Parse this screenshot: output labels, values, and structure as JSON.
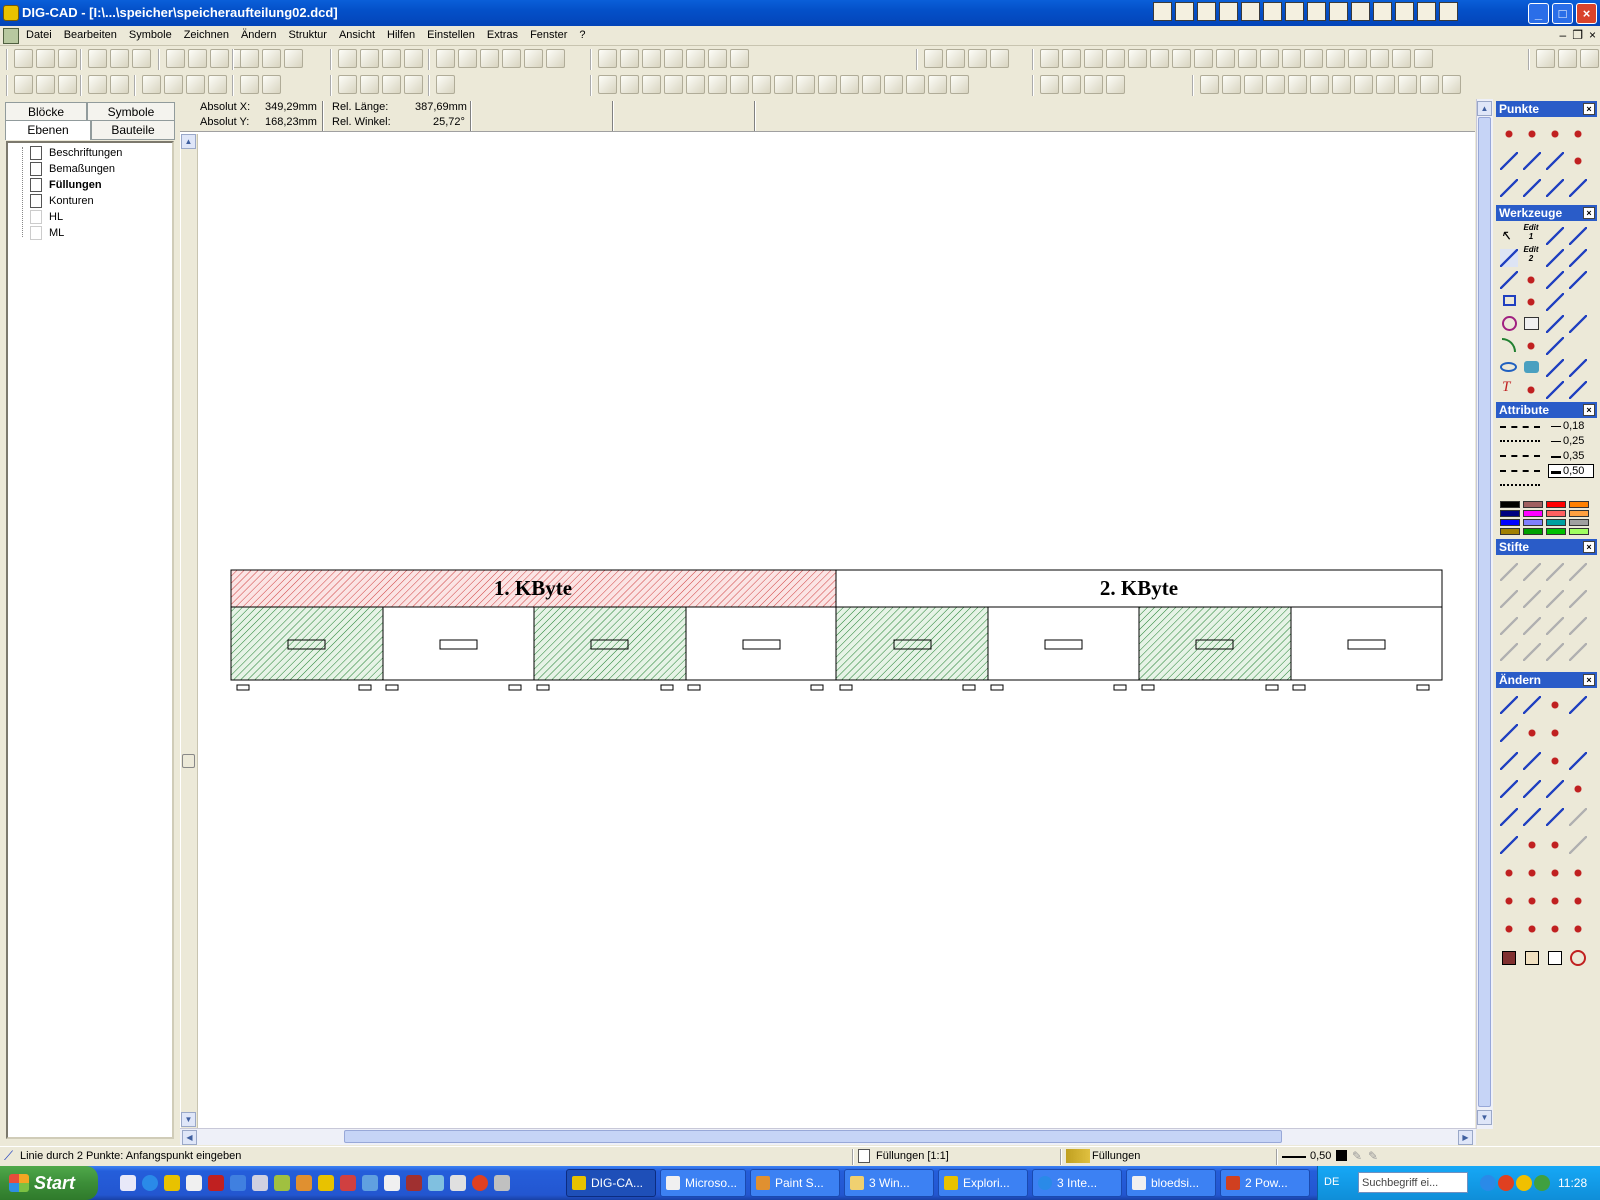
{
  "window": {
    "title": "DIG-CAD - [I:\\...\\speicher\\speicheraufteilung02.dcd]"
  },
  "menu": {
    "items": [
      "Datei",
      "Bearbeiten",
      "Symbole",
      "Zeichnen",
      "Ändern",
      "Struktur",
      "Ansicht",
      "Hilfen",
      "Einstellen",
      "Extras",
      "Fenster",
      "?"
    ]
  },
  "left_panel": {
    "tabs": [
      "Blöcke",
      "Symbole",
      "Ebenen",
      "Bauteile"
    ],
    "tree": [
      {
        "label": "Beschriftungen",
        "bold": false
      },
      {
        "label": "Bemaßungen",
        "bold": false
      },
      {
        "label": "Füllungen",
        "bold": true
      },
      {
        "label": "Konturen",
        "bold": false
      },
      {
        "label": "HL",
        "bold": false
      },
      {
        "label": "ML",
        "bold": false
      }
    ]
  },
  "coords": {
    "abs_x_label": "Absolut X:",
    "abs_x_value": "349,29mm",
    "abs_y_label": "Absolut Y:",
    "abs_y_value": "168,23mm",
    "rel_len_label": "Rel. Länge:",
    "rel_len_value": "387,69mm",
    "rel_angle_label": "Rel. Winkel:",
    "rel_angle_value": "25,72°"
  },
  "drawing": {
    "byte1_label": "1. KByte",
    "byte2_label": "2. KByte",
    "hatch_red": "#d04040",
    "hatch_green": "#208030"
  },
  "palettes": {
    "punkte": "Punkte",
    "werkzeuge": "Werkzeuge",
    "attribute": "Attribute",
    "stifte": "Stifte",
    "aendern": "Ändern",
    "line_widths": [
      "0,18",
      "0,25",
      "0,35",
      "0,50"
    ],
    "edit1": "Edit",
    "edit1_num": "1",
    "edit2": "Edit",
    "edit2_num": "2",
    "colors": [
      "#000000",
      "#a06060",
      "#ff0000",
      "#ff8000",
      "#000080",
      "#ff00ff",
      "#ff6060",
      "#ffa040",
      "#0000ff",
      "#8080ff",
      "#00a0a0",
      "#a0a0a0",
      "#a08000",
      "#00a000",
      "#00c000",
      "#a0ff60"
    ]
  },
  "status": {
    "message": "Linie durch 2 Punkte: Anfangspunkt eingeben",
    "layer_scale": "Füllungen [1:1]",
    "layer": "Füllungen",
    "line_width": "0,50"
  },
  "taskbar": {
    "start": "Start",
    "tasks": [
      "DIG-CA...",
      "Microso...",
      "Paint S...",
      "3 Win...",
      "Explori...",
      "3 Inte...",
      "bloedsi...",
      "2 Pow..."
    ],
    "lang": "DE",
    "search_placeholder": "Suchbegriff ei...",
    "clock": "11:28"
  }
}
